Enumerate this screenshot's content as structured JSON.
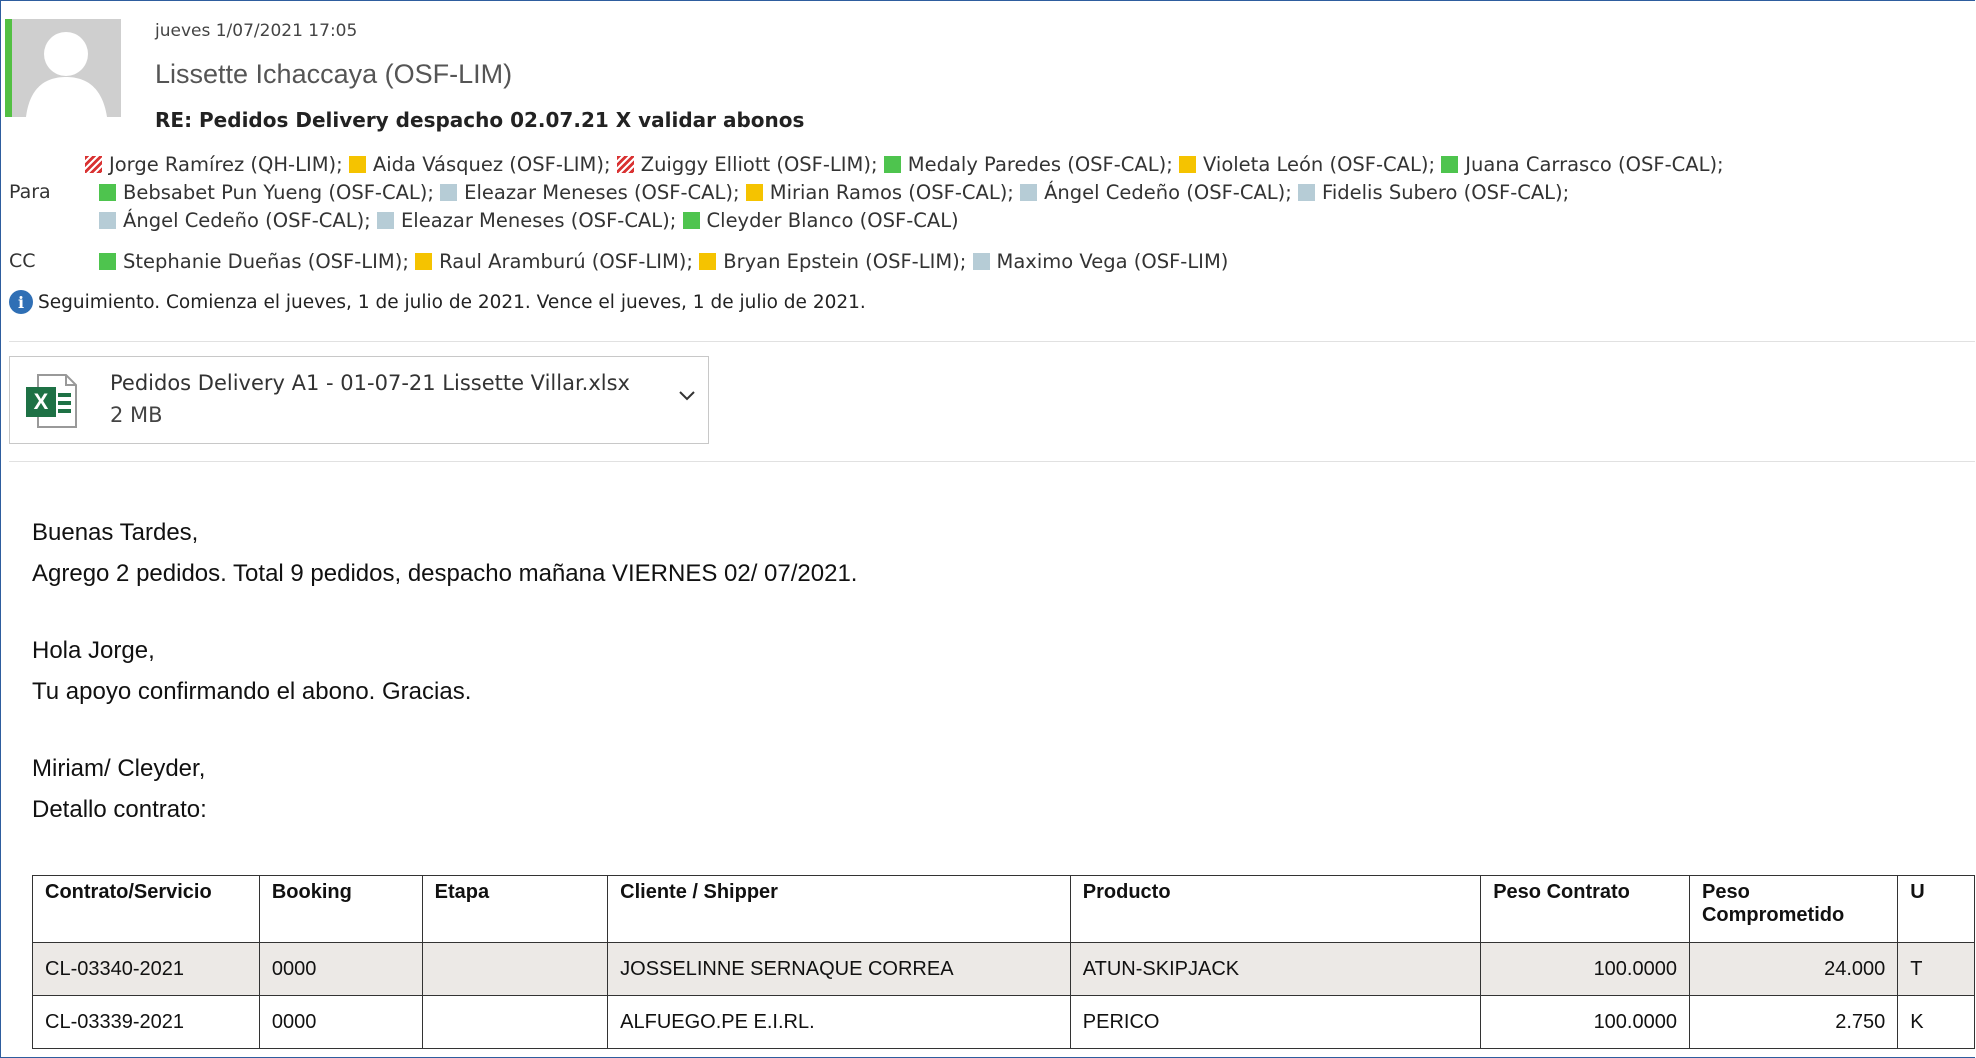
{
  "header": {
    "date": "jueves 1/07/2021 17:05",
    "sender": "Lissette Ichaccaya (OSF-LIM)",
    "subject": "RE: Pedidos Delivery despacho 02.07.21 X validar abonos"
  },
  "recipients": {
    "to_label": "Para",
    "cc_label": "CC",
    "colors": {
      "hatched": "#d93232",
      "yellow": "#f5c300",
      "green": "#4ec44e",
      "gray": "#b6ccd6"
    },
    "to_lines": [
      [
        {
          "name": "Jorge Ramírez (QH-LIM);",
          "status": "hatched"
        },
        {
          "name": "Aida Vásquez (OSF-LIM);",
          "status": "yellow"
        },
        {
          "name": "Zuiggy Elliott (OSF-LIM);",
          "status": "hatched"
        },
        {
          "name": "Medaly Paredes (OSF-CAL);",
          "status": "green"
        },
        {
          "name": "Violeta León (OSF-CAL);",
          "status": "yellow"
        },
        {
          "name": "Juana Carrasco (OSF-CAL);",
          "status": "green"
        }
      ],
      [
        {
          "name": "Bebsabet Pun Yueng (OSF-CAL);",
          "status": "green"
        },
        {
          "name": "Eleazar Meneses (OSF-CAL);",
          "status": "gray"
        },
        {
          "name": "Mirian Ramos (OSF-CAL);",
          "status": "yellow"
        },
        {
          "name": "Ángel Cedeño (OSF-CAL);",
          "status": "gray"
        },
        {
          "name": "Fidelis Subero (OSF-CAL);",
          "status": "gray"
        }
      ],
      [
        {
          "name": "Ángel Cedeño (OSF-CAL);",
          "status": "gray"
        },
        {
          "name": "Eleazar Meneses (OSF-CAL);",
          "status": "gray"
        },
        {
          "name": "Cleyder Blanco (OSF-CAL)",
          "status": "green"
        }
      ]
    ],
    "cc": [
      {
        "name": "Stephanie Dueñas (OSF-LIM);",
        "status": "green"
      },
      {
        "name": "Raul Aramburú (OSF-LIM);",
        "status": "yellow"
      },
      {
        "name": "Bryan Epstein (OSF-LIM);",
        "status": "yellow"
      },
      {
        "name": "Maximo Vega (OSF-LIM)",
        "status": "gray"
      }
    ]
  },
  "followup": {
    "icon": "info-icon",
    "text": "Seguimiento.  Comienza el jueves, 1 de julio de 2021.  Vence el jueves, 1 de julio de 2021."
  },
  "attachment": {
    "icon": "excel-icon",
    "name": "Pedidos Delivery A1 - 01-07-21 Lissette Villar.xlsx",
    "size": "2 MB"
  },
  "body": {
    "line1": "Buenas Tardes,",
    "line2": "Agrego 2 pedidos. Total  9 pedidos, despacho mañana VIERNES 02/ 07/2021.",
    "line3": "Hola Jorge,",
    "line4": "Tu apoyo confirmando el abono. Gracias.",
    "line5": "Miriam/ Cleyder,",
    "line6": "Detallo contrato:"
  },
  "table": {
    "headers": [
      "Contrato/Servicio",
      "Booking",
      "Etapa",
      "Cliente / Shipper",
      "Producto",
      "Peso Contrato",
      "Peso Comprometido",
      "U"
    ],
    "rows": [
      [
        "CL-03340-2021",
        "0000",
        "",
        "JOSSELINNE SERNAQUE CORREA",
        "ATUN-SKIPJACK",
        "100.0000",
        "24.000",
        "T"
      ],
      [
        "CL-03339-2021",
        "0000",
        "",
        "ALFUEGO.PE E.I.RL.",
        "PERICO",
        "100.0000",
        "2.750",
        "K"
      ]
    ]
  }
}
